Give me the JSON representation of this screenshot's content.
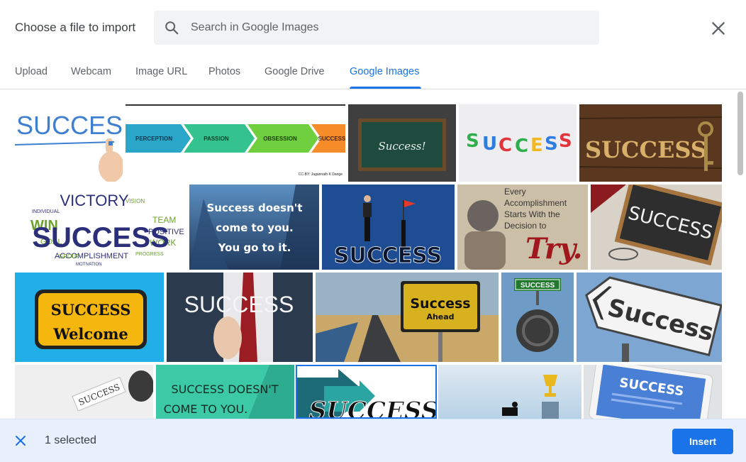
{
  "dialog": {
    "title": "Choose a file to import",
    "close_icon": "close-icon"
  },
  "search": {
    "placeholder": "Search in Google Images",
    "value": "",
    "icon": "search-icon"
  },
  "tabs": [
    {
      "label": "Upload",
      "active": false
    },
    {
      "label": "Webcam",
      "active": false
    },
    {
      "label": "Image URL",
      "active": false
    },
    {
      "label": "Photos",
      "active": false
    },
    {
      "label": "Google Drive",
      "active": false
    },
    {
      "label": "Google Images",
      "active": true
    }
  ],
  "images": {
    "img1": {
      "text": "SUCCESS"
    },
    "img2": {
      "steps": [
        "PERCEPTION",
        "PASSION",
        "OBSESSION",
        "SUCCESS"
      ],
      "credit": "CC-BY: Jagannath K Dange"
    },
    "img3": {
      "text": "Success!"
    },
    "img4": {
      "letters": [
        "S",
        "U",
        "C",
        "C",
        "E",
        "S",
        "S"
      ]
    },
    "img5": {
      "text": "SUCCESS"
    },
    "img6": {
      "main": "SUCCESS",
      "words": [
        "VICTORY",
        "WIN",
        "GOAL",
        "TEAM",
        "POSITIVE",
        "WORK",
        "ACCOMPLISHMENT",
        "GROUP",
        "PROGRESS",
        "INDIVIDUAL",
        "VISION",
        "MOTIVATION"
      ]
    },
    "img7": {
      "lines": [
        "Success doesn't",
        "come to you.",
        "You go to it."
      ]
    },
    "img8": {
      "text": "SUCCESS"
    },
    "img9": {
      "lines": [
        "Every",
        "Accomplishment",
        "Starts With the",
        "Decision to"
      ],
      "emphasis": "Try."
    },
    "img10": {
      "text": "SUCCESS"
    },
    "img11": {
      "line1": "SUCCESS",
      "line2": "Welcome"
    },
    "img12": {
      "text": "SUCCESS"
    },
    "img13": {
      "line1": "Success",
      "line2": "Ahead"
    },
    "img14": {
      "text": "SUCCESS"
    },
    "img15": {
      "text": "Success"
    },
    "img16": {
      "text": "SUCCESS"
    },
    "img17": {
      "lines": [
        "SUCCESS DOESN'T",
        "COME TO YOU."
      ]
    },
    "img18": {
      "text": "SUCCESS",
      "selected": true
    },
    "img19": {
      "text": ""
    },
    "img20": {
      "text": "SUCCESS"
    }
  },
  "footer": {
    "selected_count": "1 selected",
    "insert_label": "Insert",
    "close_icon": "close-icon"
  },
  "colors": {
    "accent": "#1a73e8",
    "footer_bg": "#e8f0fe"
  }
}
